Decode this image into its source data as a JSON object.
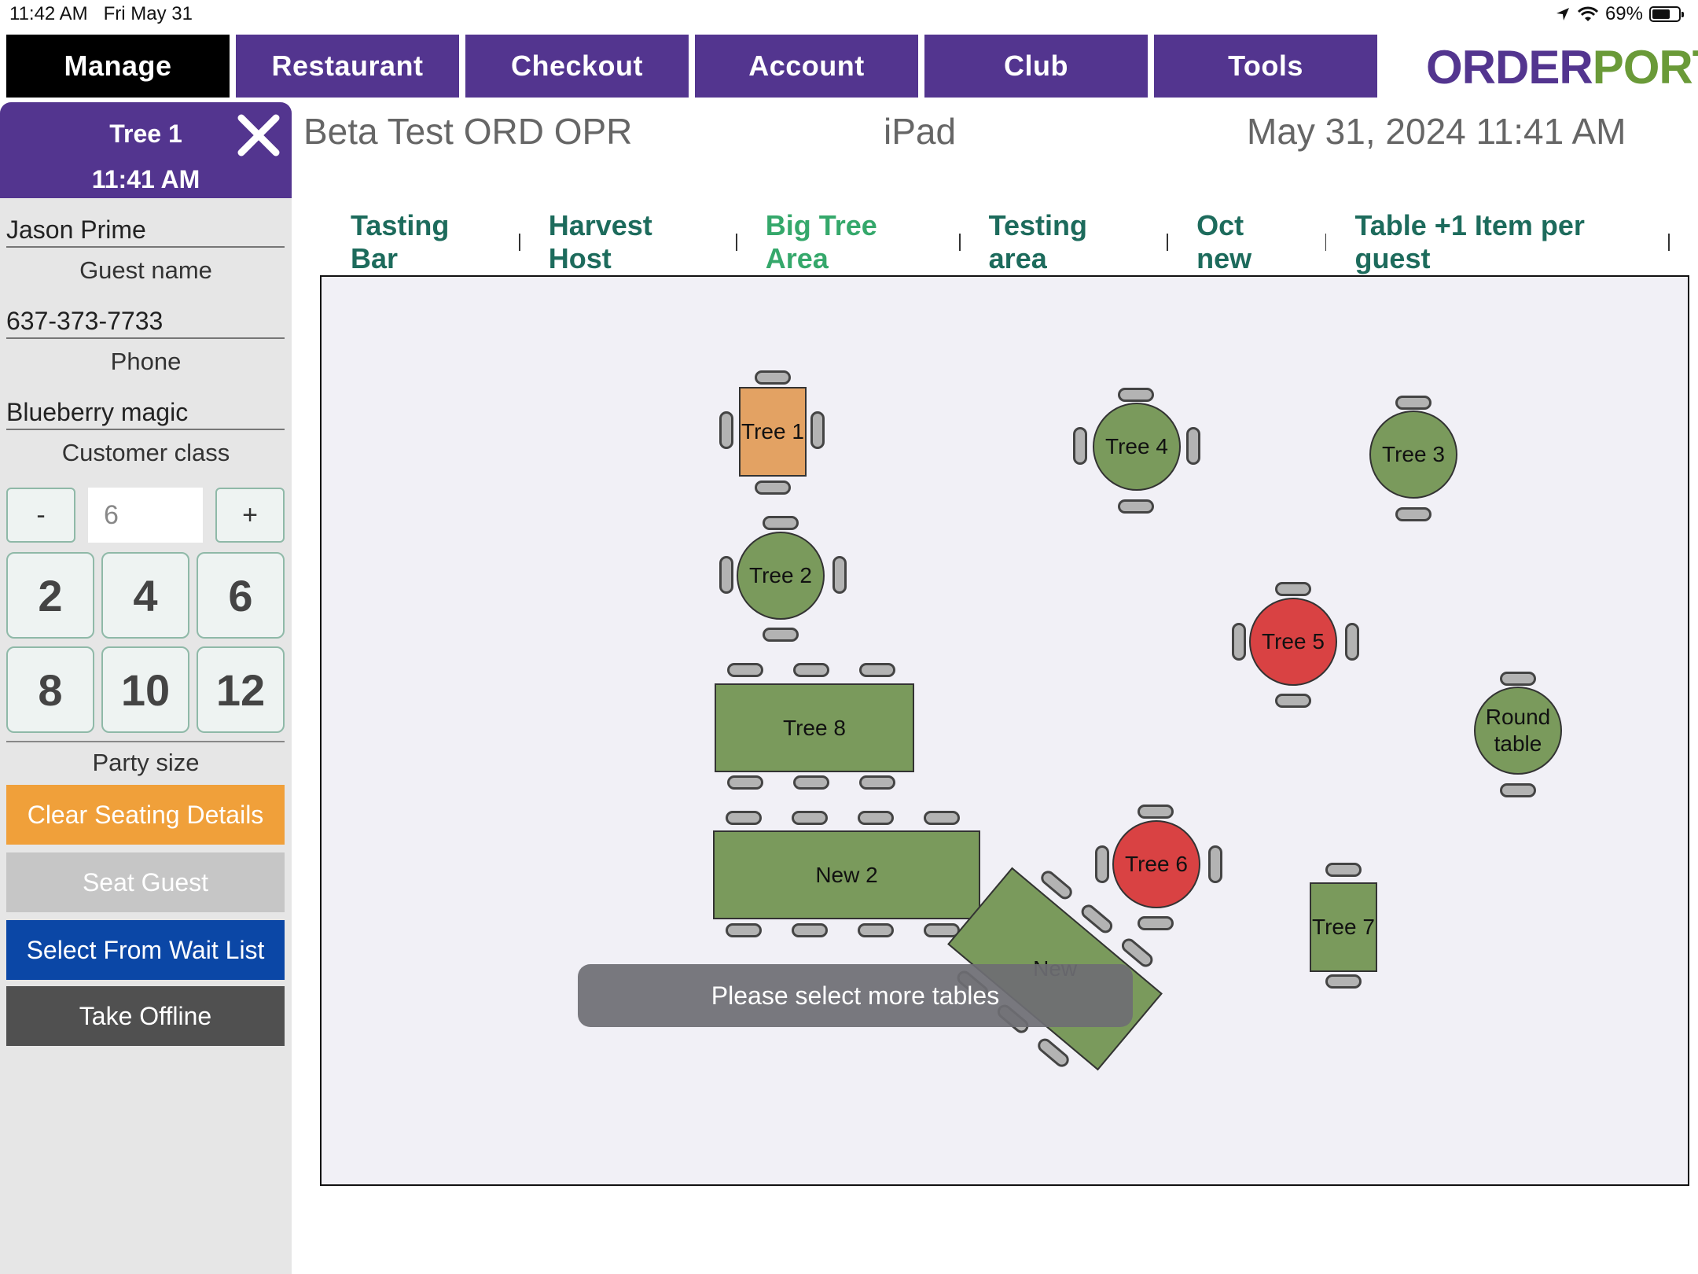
{
  "status_bar": {
    "time": "11:42 AM",
    "date": "Fri May 31",
    "battery": "69%",
    "battery_level": 0.69
  },
  "nav": {
    "items": [
      "Manage",
      "Restaurant",
      "Checkout",
      "Account",
      "Club",
      "Tools"
    ],
    "active": "Manage"
  },
  "logo": {
    "text_a": "ORDER",
    "text_b": "PORT"
  },
  "panel": {
    "table_name": "Tree 1",
    "time": "11:41 AM",
    "guest_name_value": "Jason Prime",
    "guest_name_label": "Guest name",
    "phone_value": "637-373-7733",
    "phone_label": "Phone",
    "customer_class_value": "Blueberry magic",
    "customer_class_label": "Customer class",
    "minus": "-",
    "plus": "+",
    "party_value": "6",
    "sizes": [
      "2",
      "4",
      "6",
      "8",
      "10",
      "12"
    ],
    "party_size_label": "Party size",
    "clear": "Clear Seating  Details",
    "seat": "Seat Guest",
    "waitlist": "Select From Wait List",
    "offline": "Take Offline"
  },
  "header": {
    "location": "Beta Test ORD OPR",
    "device": "iPad",
    "datetime": "May 31, 2024 11:41 AM"
  },
  "areas": [
    "Tasting Bar",
    "Harvest Host",
    "Big Tree Area",
    "Testing area",
    "Oct new",
    "Table +1 Item per guest"
  ],
  "active_area": "Big Tree Area",
  "tables": {
    "tree1": "Tree 1",
    "tree2": "Tree 2",
    "tree3": "Tree 3",
    "tree4": "Tree 4",
    "tree5": "Tree 5",
    "tree6": "Tree 6",
    "tree7": "Tree 7",
    "tree8": "Tree 8",
    "new2": "New 2",
    "new": "New",
    "round_line1": "Round",
    "round_line2": "table"
  },
  "toast": "Please select more tables",
  "colors": {
    "nav": "#53358f",
    "available": "#7a9a5c",
    "occupied": "#d94243",
    "selected": "#e3a263",
    "clear": "#f0a03a",
    "waitlist": "#0b47a6",
    "offline": "#505050",
    "seat": "#c6c6c6"
  }
}
